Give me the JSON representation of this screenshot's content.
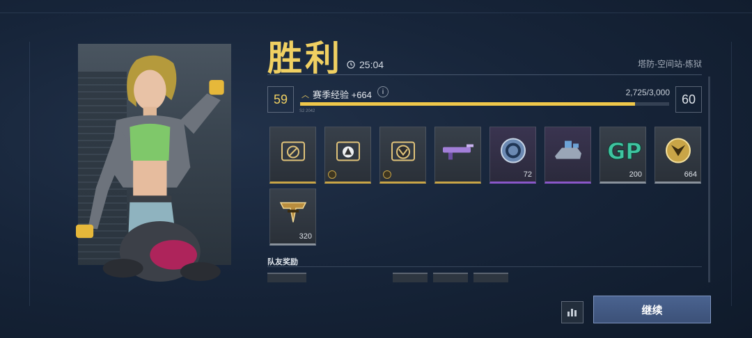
{
  "header": {
    "result_title": "胜利",
    "match_time": "25:04",
    "map_name": "塔防-空间站-炼狱"
  },
  "progress": {
    "current_level": "59",
    "next_level": "60",
    "xp_label": "赛季经验 +664",
    "xp_count": "2,725/3,000",
    "xp_fraction": 0.908,
    "season_tag": "S2 2042"
  },
  "rewards": [
    {
      "icon": "gold-folder-icon",
      "rarity": "gold",
      "count": ""
    },
    {
      "icon": "warning-folder-icon",
      "rarity": "gold",
      "count": ""
    },
    {
      "icon": "emblem-folder-icon",
      "rarity": "gold",
      "count": ""
    },
    {
      "icon": "weapon-skin-icon",
      "rarity": "gold",
      "count": ""
    },
    {
      "icon": "blue-token-icon",
      "rarity": "purple",
      "count": "72"
    },
    {
      "icon": "vehicle-icon",
      "rarity": "purple",
      "count": ""
    },
    {
      "icon": "gp-currency-icon",
      "rarity": "gray",
      "count": "200"
    },
    {
      "icon": "season-coin-icon",
      "rarity": "gray",
      "count": "664"
    },
    {
      "icon": "rank-badge-icon",
      "rarity": "gray",
      "count": "320"
    }
  ],
  "team": {
    "label": "队友奖励"
  },
  "buttons": {
    "continue_label": "继续"
  },
  "colors": {
    "accent_gold": "#f0d062",
    "purple_rarity": "#8a57c9",
    "button_blue": "#4a6390"
  }
}
